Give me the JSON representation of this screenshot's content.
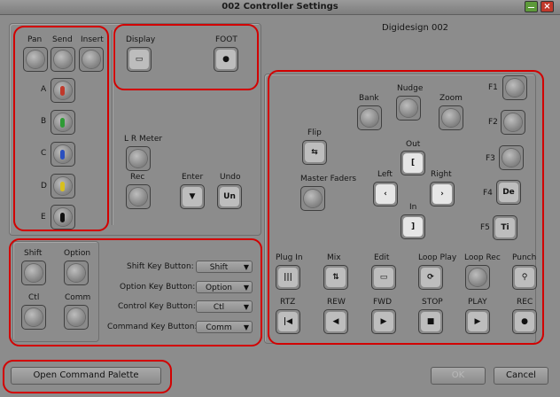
{
  "window": {
    "title": "002 Controller Settings",
    "close_glyph": "×",
    "subtitle": "Digidesign 002"
  },
  "top_left": {
    "col_labels": [
      "Pan",
      "Send",
      "Insert"
    ],
    "rows": [
      {
        "label": "A",
        "color": "#c0392b"
      },
      {
        "label": "B",
        "color": "#2e9b35"
      },
      {
        "label": "C",
        "color": "#2a4fbf"
      },
      {
        "label": "D",
        "color": "#d8c01e"
      },
      {
        "label": "E",
        "color": "#111111"
      }
    ]
  },
  "display_group": {
    "display_label": "Display",
    "foot_label": "FOOT"
  },
  "meter_group": {
    "lr_meter": "L R Meter",
    "rec": "Rec",
    "enter": "Enter",
    "undo": "Undo",
    "undo_glyph": "Un"
  },
  "right_panel": {
    "bank": "Bank",
    "nudge": "Nudge",
    "zoom": "Zoom",
    "flip": "Flip",
    "master_faders": "Master Faders",
    "out": "Out",
    "left": "Left",
    "right": "Right",
    "in": "In",
    "f_keys": [
      "F1",
      "F2",
      "F3",
      "F4",
      "F5"
    ],
    "f4_glyph": "De",
    "f5_glyph": "Ti",
    "row1": [
      "Plug In",
      "Mix",
      "Edit",
      "Loop Play",
      "Loop Rec",
      "Punch"
    ],
    "row2": [
      "RTZ",
      "REW",
      "FWD",
      "STOP",
      "PLAY",
      "REC"
    ]
  },
  "modifiers": {
    "labels": [
      "Shift",
      "Option",
      "Ctl",
      "Comm"
    ],
    "key_rows": [
      {
        "label": "Shift Key Button:",
        "value": "Shift"
      },
      {
        "label": "Option Key Button:",
        "value": "Option"
      },
      {
        "label": "Control Key Button:",
        "value": "Ctl"
      },
      {
        "label": "Command Key Button:",
        "value": "Comm"
      }
    ]
  },
  "footer": {
    "open_palette": "Open Command Palette",
    "ok": "OK",
    "cancel": "Cancel"
  }
}
